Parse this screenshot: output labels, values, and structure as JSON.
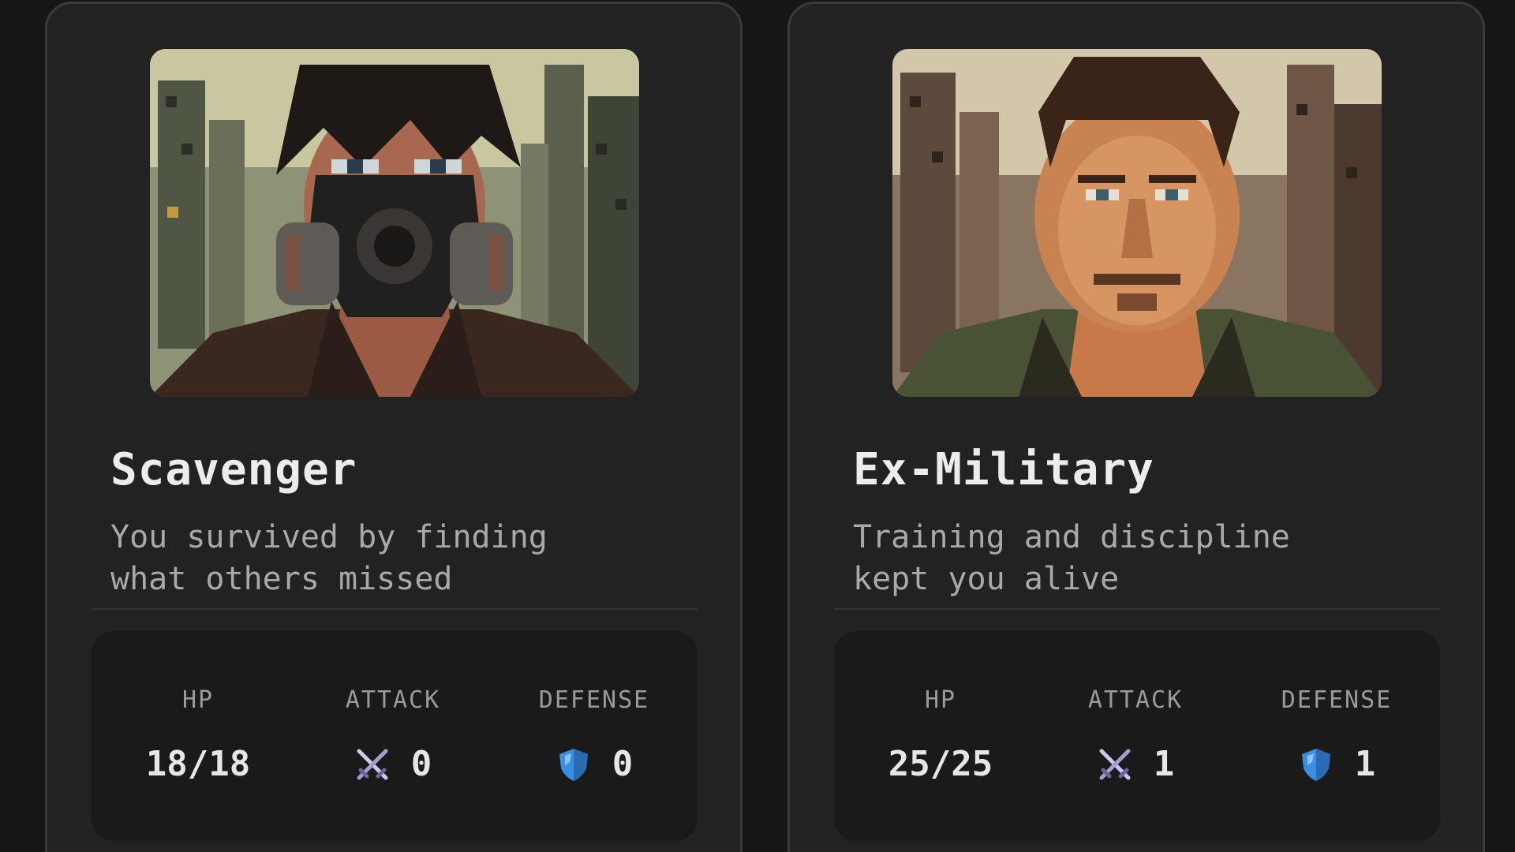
{
  "characters": [
    {
      "name": "Scavenger",
      "description": "You survived by finding\nwhat others missed",
      "portrait": "gas-mask-survivor-portrait",
      "stats": {
        "hp_label": "HP",
        "hp_value": "18/18",
        "attack_label": "ATTACK",
        "attack_value": "0",
        "attack_icon": "crossed-swords-icon",
        "defense_label": "DEFENSE",
        "defense_value": "0",
        "defense_icon": "shield-icon"
      }
    },
    {
      "name": "Ex-Military",
      "description": "Training and discipline\nkept you alive",
      "portrait": "soldier-portrait",
      "stats": {
        "hp_label": "HP",
        "hp_value": "25/25",
        "attack_label": "ATTACK",
        "attack_value": "1",
        "attack_icon": "crossed-swords-icon",
        "defense_label": "DEFENSE",
        "defense_value": "1",
        "defense_icon": "shield-icon"
      }
    }
  ],
  "colors": {
    "background": "#161616",
    "card": "#222222",
    "card_border": "#3a3a3a",
    "stats_panel": "#1a1a1a",
    "shield_blue": "#3b8fe0",
    "sword_purple": "#a79bd0"
  }
}
